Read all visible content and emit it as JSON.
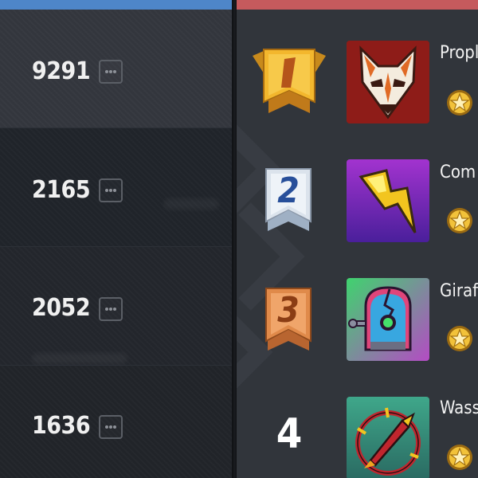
{
  "colors": {
    "team_left": "#4e86c9",
    "team_right": "#c55a5d",
    "gold": "#f1b52c",
    "silver": "#d9e1ea",
    "bronze": "#dd8143"
  },
  "left_panel": {
    "rows": [
      {
        "score": "9291",
        "more_icon": "more-dots-icon",
        "highlighted": true
      },
      {
        "score": "2165",
        "more_icon": "more-dots-icon",
        "highlighted": false
      },
      {
        "score": "2052",
        "more_icon": "more-dots-icon",
        "highlighted": false
      },
      {
        "score": "1636",
        "more_icon": "more-dots-icon",
        "highlighted": false
      }
    ]
  },
  "right_panel": {
    "rows": [
      {
        "rank": "1",
        "rank_style": "gold-ribbon",
        "avatar": "fox-mask-avatar",
        "name": "Propl",
        "badge_icon": "star-coin-icon"
      },
      {
        "rank": "2",
        "rank_style": "silver-ribbon",
        "avatar": "lightning-bolt-avatar",
        "name": "Com",
        "badge_icon": "star-coin-icon"
      },
      {
        "rank": "3",
        "rank_style": "bronze-ribbon",
        "avatar": "robot-head-avatar",
        "name": "Giraf",
        "badge_icon": "star-coin-icon"
      },
      {
        "rank": "4",
        "rank_style": "plain",
        "avatar": "rocket-target-avatar",
        "name": "Wass",
        "badge_icon": "star-coin-icon"
      }
    ]
  }
}
